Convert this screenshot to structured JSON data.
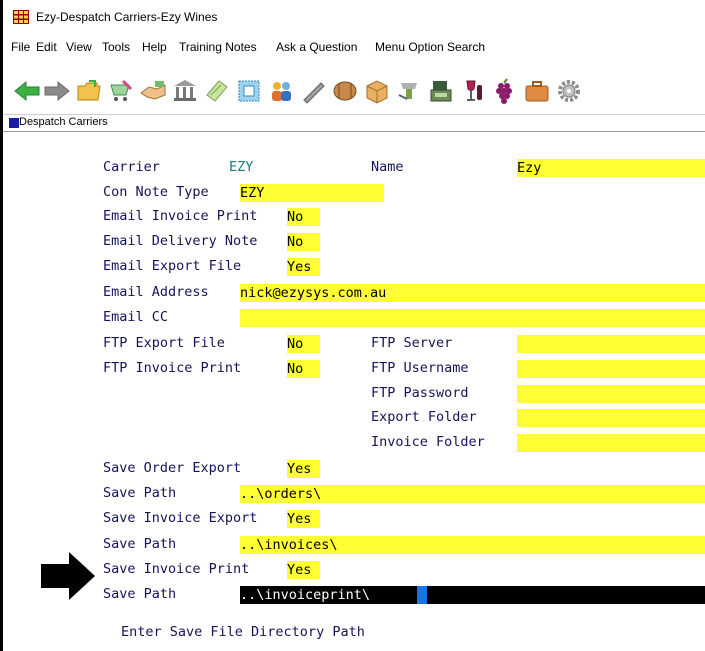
{
  "window": {
    "title": "Ezy-Despatch Carriers-Ezy Wines",
    "icon": "app-grid-icon"
  },
  "menu": [
    {
      "id": "file",
      "label": "File"
    },
    {
      "id": "edit",
      "label": "Edit"
    },
    {
      "id": "view",
      "label": "View"
    },
    {
      "id": "tools",
      "label": "Tools"
    },
    {
      "id": "help",
      "label": "Help"
    },
    {
      "id": "training",
      "label": "Training Notes"
    },
    {
      "id": "ask",
      "label": "Ask a Question"
    },
    {
      "id": "search",
      "label": "Menu Option Search"
    }
  ],
  "toolbar_icons": [
    "back-arrow-icon",
    "forward-arrow-icon",
    "folder-icon",
    "cart-icon",
    "handshake-icon",
    "bank-icon",
    "payment-icon",
    "stamp-icon",
    "users-icon",
    "pen-icon",
    "barrel-icon",
    "box-icon",
    "dispenser-icon",
    "cash-register-icon",
    "wine-glass-icon",
    "grapes-icon",
    "briefcase-icon",
    "gear-icon"
  ],
  "panel": {
    "title": "Despatch Carriers"
  },
  "form": {
    "carrier_label": "Carrier",
    "carrier_value": "EZY",
    "name_label": "Name",
    "name_value": "Ezy",
    "con_note_label": "Con Note Type",
    "con_note_value": "EZY",
    "email_invoice_print_label": "Email Invoice Print",
    "email_invoice_print_value": "No",
    "email_delivery_note_label": "Email Delivery Note",
    "email_delivery_note_value": "No",
    "email_export_file_label": "Email Export File",
    "email_export_file_value": "Yes",
    "email_address_label": "Email Address",
    "email_address_value": "nick@ezysys.com.au",
    "email_cc_label": "Email CC",
    "email_cc_value": "",
    "ftp_export_file_label": "FTP Export File",
    "ftp_export_file_value": "No",
    "ftp_server_label": "FTP Server",
    "ftp_server_value": "",
    "ftp_invoice_print_label": "FTP Invoice Print",
    "ftp_invoice_print_value": "No",
    "ftp_username_label": "FTP Username",
    "ftp_username_value": "",
    "ftp_password_label": "FTP Password",
    "ftp_password_value": "",
    "export_folder_label": "Export Folder",
    "export_folder_value": "",
    "invoice_folder_label": "Invoice Folder",
    "invoice_folder_value": "",
    "save_order_export_label": "Save Order Export",
    "save_order_export_value": "Yes",
    "save_path_1_label": "Save Path",
    "save_path_1_value": "..\\orders\\",
    "save_invoice_export_label": "Save Invoice Export",
    "save_invoice_export_value": "Yes",
    "save_path_2_label": "Save Path",
    "save_path_2_value": "..\\invoices\\",
    "save_invoice_print_label": "Save Invoice Print",
    "save_invoice_print_value": "Yes",
    "save_path_3_label": "Save Path",
    "save_path_3_value": "..\\invoiceprint\\"
  },
  "status": {
    "prompt": "Enter Save File Directory Path"
  },
  "colors": {
    "field": "#ffff33",
    "label": "#14145a",
    "active_field": "#000000",
    "cursor": "#1a73e8"
  }
}
